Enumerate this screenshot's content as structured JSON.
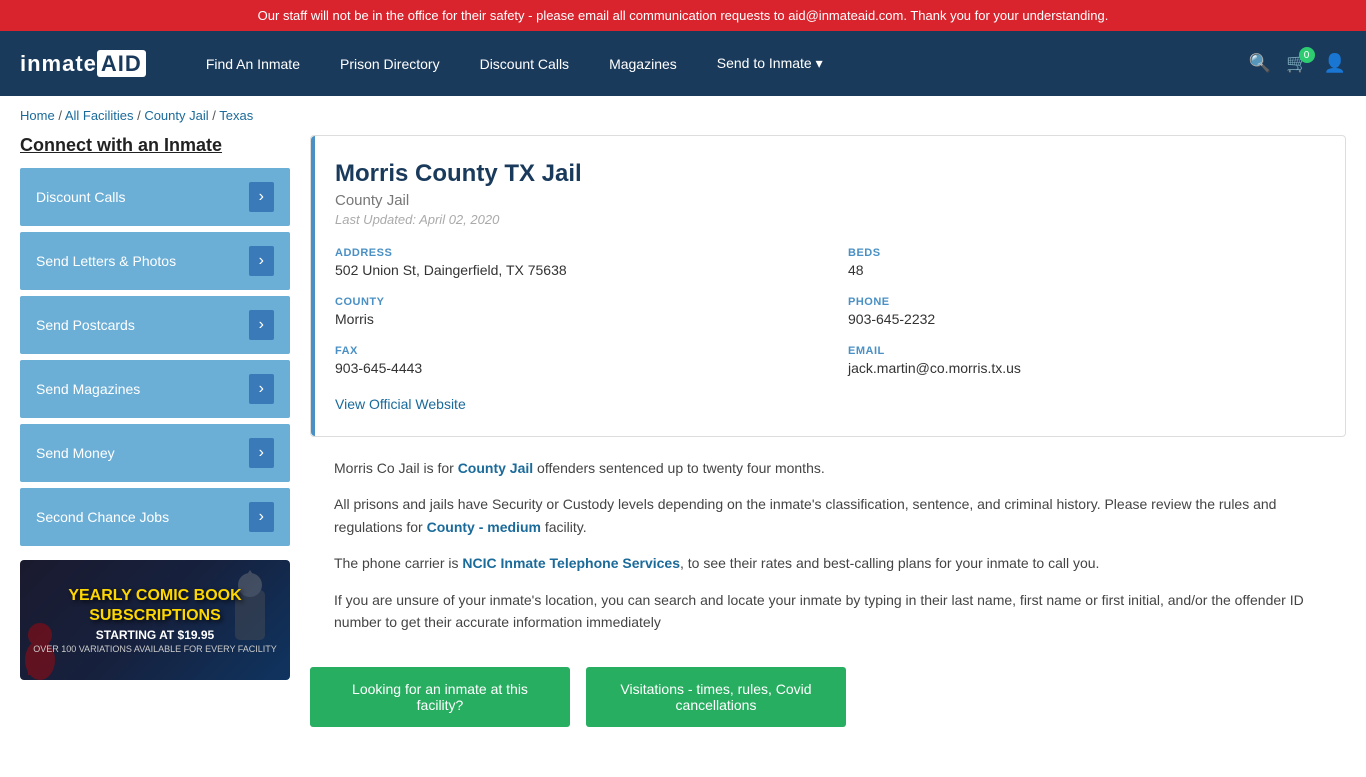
{
  "alert": {
    "text": "Our staff will not be in the office for their safety - please email all communication requests to aid@inmateaid.com. Thank you for your understanding."
  },
  "nav": {
    "logo_prefix": "inmate",
    "logo_suffix": "AID",
    "links": [
      {
        "label": "Find An Inmate",
        "id": "find-inmate"
      },
      {
        "label": "Prison Directory",
        "id": "prison-directory"
      },
      {
        "label": "Discount Calls",
        "id": "discount-calls"
      },
      {
        "label": "Magazines",
        "id": "magazines"
      },
      {
        "label": "Send to Inmate ▾",
        "id": "send-to-inmate"
      }
    ],
    "cart_count": "0"
  },
  "breadcrumb": {
    "items": [
      "Home",
      "All Facilities",
      "County Jail",
      "Texas"
    ]
  },
  "sidebar": {
    "title": "Connect with an Inmate",
    "buttons": [
      {
        "label": "Discount Calls"
      },
      {
        "label": "Send Letters & Photos"
      },
      {
        "label": "Send Postcards"
      },
      {
        "label": "Send Magazines"
      },
      {
        "label": "Send Money"
      },
      {
        "label": "Second Chance Jobs"
      }
    ],
    "ad": {
      "title": "YEARLY COMIC BOOK\nSUBSCRIPTIONS",
      "subtitle": "STARTING AT $19.95",
      "note": "OVER 100 VARIATIONS AVAILABLE FOR EVERY FACILITY"
    }
  },
  "facility": {
    "name": "Morris County TX Jail",
    "type": "County Jail",
    "last_updated": "Last Updated: April 02, 2020",
    "address_label": "ADDRESS",
    "address_value": "502 Union St, Daingerfield, TX 75638",
    "beds_label": "BEDS",
    "beds_value": "48",
    "county_label": "COUNTY",
    "county_value": "Morris",
    "phone_label": "PHONE",
    "phone_value": "903-645-2232",
    "fax_label": "FAX",
    "fax_value": "903-645-4443",
    "email_label": "EMAIL",
    "email_value": "jack.martin@co.morris.tx.us",
    "official_link": "View Official Website"
  },
  "description": {
    "para1": "Morris Co Jail is for County Jail offenders sentenced up to twenty four months.",
    "para2": "All prisons and jails have Security or Custody levels depending on the inmate's classification, sentence, and criminal history. Please review the rules and regulations for County - medium facility.",
    "para3": "The phone carrier is NCIC Inmate Telephone Services, to see their rates and best-calling plans for your inmate to call you.",
    "para4": "If you are unsure of your inmate's location, you can search and locate your inmate by typing in their last name, first name or first initial, and/or the offender ID number to get their accurate information immediately"
  },
  "buttons": {
    "looking": "Looking for an inmate at this facility?",
    "visitations": "Visitations - times, rules, Covid cancellations"
  }
}
